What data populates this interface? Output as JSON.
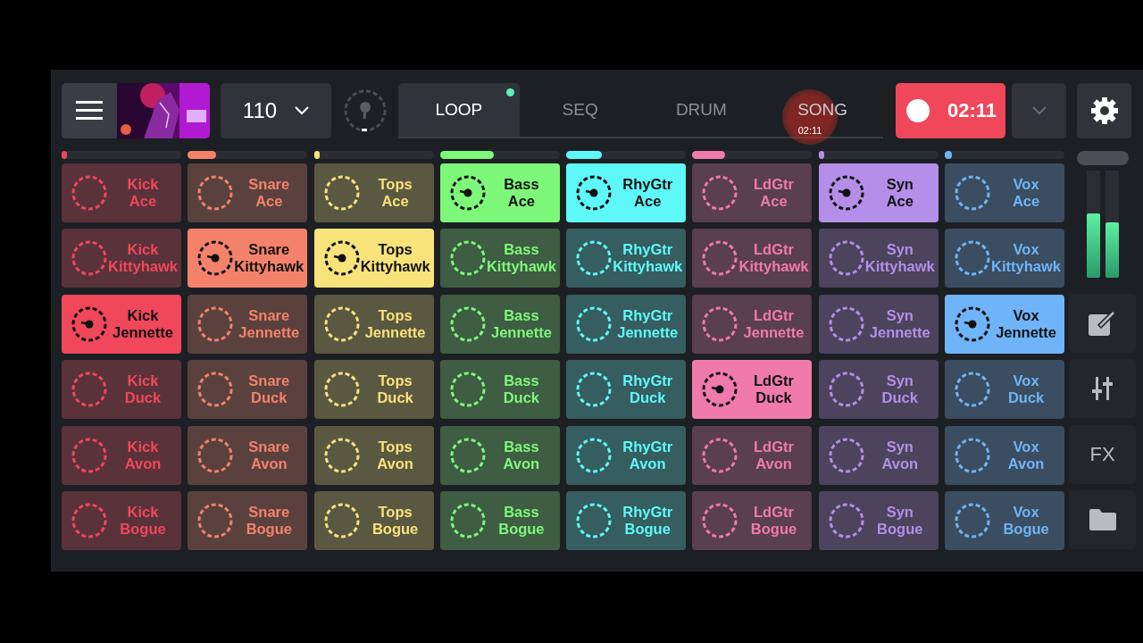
{
  "top_bar": {
    "tempo": "110",
    "tabs": [
      {
        "label": "LOOP",
        "selected": true,
        "indicator": true
      },
      {
        "label": "SEQ",
        "selected": false,
        "indicator": false
      },
      {
        "label": "DRUM",
        "selected": false,
        "indicator": false
      },
      {
        "label": "SONG",
        "selected": false,
        "indicator": false
      }
    ],
    "touch_indicator": "02:11",
    "record": {
      "time": "02:11",
      "recording": true
    }
  },
  "tracks": [
    {
      "color": "#f0475a",
      "level": 0.03
    },
    {
      "color": "#f4826a",
      "level": 0.24
    },
    {
      "color": "#f8e27a",
      "level": 0.05
    },
    {
      "color": "#7ef87a",
      "level": 0.45
    },
    {
      "color": "#5ef8f8",
      "level": 0.3
    },
    {
      "color": "#f07aac",
      "level": 0.27
    },
    {
      "color": "#b48ee8",
      "level": 0.03
    },
    {
      "color": "#6fb4f8",
      "level": 0.06
    }
  ],
  "rows": [
    {
      "pads": [
        {
          "track": "Kick",
          "clip": "Ace",
          "playing": false
        },
        {
          "track": "Snare",
          "clip": "Ace",
          "playing": false
        },
        {
          "track": "Tops",
          "clip": "Ace",
          "playing": false
        },
        {
          "track": "Bass",
          "clip": "Ace",
          "playing": true
        },
        {
          "track": "RhyGtr",
          "clip": "Ace",
          "playing": true
        },
        {
          "track": "LdGtr",
          "clip": "Ace",
          "playing": false
        },
        {
          "track": "Syn",
          "clip": "Ace",
          "playing": true
        },
        {
          "track": "Vox",
          "clip": "Ace",
          "playing": false
        }
      ]
    },
    {
      "pads": [
        {
          "track": "Kick",
          "clip": "Kittyhawk",
          "playing": false
        },
        {
          "track": "Snare",
          "clip": "Kittyhawk",
          "playing": true
        },
        {
          "track": "Tops",
          "clip": "Kittyhawk",
          "playing": true
        },
        {
          "track": "Bass",
          "clip": "Kittyhawk",
          "playing": false
        },
        {
          "track": "RhyGtr",
          "clip": "Kittyhawk",
          "playing": false
        },
        {
          "track": "LdGtr",
          "clip": "Kittyhawk",
          "playing": false
        },
        {
          "track": "Syn",
          "clip": "Kittyhawk",
          "playing": false
        },
        {
          "track": "Vox",
          "clip": "Kittyhawk",
          "playing": false
        }
      ]
    },
    {
      "pads": [
        {
          "track": "Kick",
          "clip": "Jennette",
          "playing": true
        },
        {
          "track": "Snare",
          "clip": "Jennette",
          "playing": false
        },
        {
          "track": "Tops",
          "clip": "Jennette",
          "playing": false
        },
        {
          "track": "Bass",
          "clip": "Jennette",
          "playing": false
        },
        {
          "track": "RhyGtr",
          "clip": "Jennette",
          "playing": false
        },
        {
          "track": "LdGtr",
          "clip": "Jennette",
          "playing": false
        },
        {
          "track": "Syn",
          "clip": "Jennette",
          "playing": false
        },
        {
          "track": "Vox",
          "clip": "Jennette",
          "playing": true
        }
      ]
    },
    {
      "pads": [
        {
          "track": "Kick",
          "clip": "Duck",
          "playing": false
        },
        {
          "track": "Snare",
          "clip": "Duck",
          "playing": false
        },
        {
          "track": "Tops",
          "clip": "Duck",
          "playing": false
        },
        {
          "track": "Bass",
          "clip": "Duck",
          "playing": false
        },
        {
          "track": "RhyGtr",
          "clip": "Duck",
          "playing": false
        },
        {
          "track": "LdGtr",
          "clip": "Duck",
          "playing": true
        },
        {
          "track": "Syn",
          "clip": "Duck",
          "playing": false
        },
        {
          "track": "Vox",
          "clip": "Duck",
          "playing": false
        }
      ]
    },
    {
      "pads": [
        {
          "track": "Kick",
          "clip": "Avon",
          "playing": false
        },
        {
          "track": "Snare",
          "clip": "Avon",
          "playing": false
        },
        {
          "track": "Tops",
          "clip": "Avon",
          "playing": false
        },
        {
          "track": "Bass",
          "clip": "Avon",
          "playing": false
        },
        {
          "track": "RhyGtr",
          "clip": "Avon",
          "playing": false
        },
        {
          "track": "LdGtr",
          "clip": "Avon",
          "playing": false
        },
        {
          "track": "Syn",
          "clip": "Avon",
          "playing": false
        },
        {
          "track": "Vox",
          "clip": "Avon",
          "playing": false
        }
      ]
    },
    {
      "pads": [
        {
          "track": "Kick",
          "clip": "Bogue",
          "playing": false
        },
        {
          "track": "Snare",
          "clip": "Bogue",
          "playing": false
        },
        {
          "track": "Tops",
          "clip": "Bogue",
          "playing": false
        },
        {
          "track": "Bass",
          "clip": "Bogue",
          "playing": false
        },
        {
          "track": "RhyGtr",
          "clip": "Bogue",
          "playing": false
        },
        {
          "track": "LdGtr",
          "clip": "Bogue",
          "playing": false
        },
        {
          "track": "Syn",
          "clip": "Bogue",
          "playing": false
        },
        {
          "track": "Vox",
          "clip": "Bogue",
          "playing": false
        }
      ]
    }
  ],
  "master_meter": [
    {
      "level": 0.6
    },
    {
      "level": 0.52
    }
  ],
  "sidebar": {
    "fx_label": "FX"
  }
}
